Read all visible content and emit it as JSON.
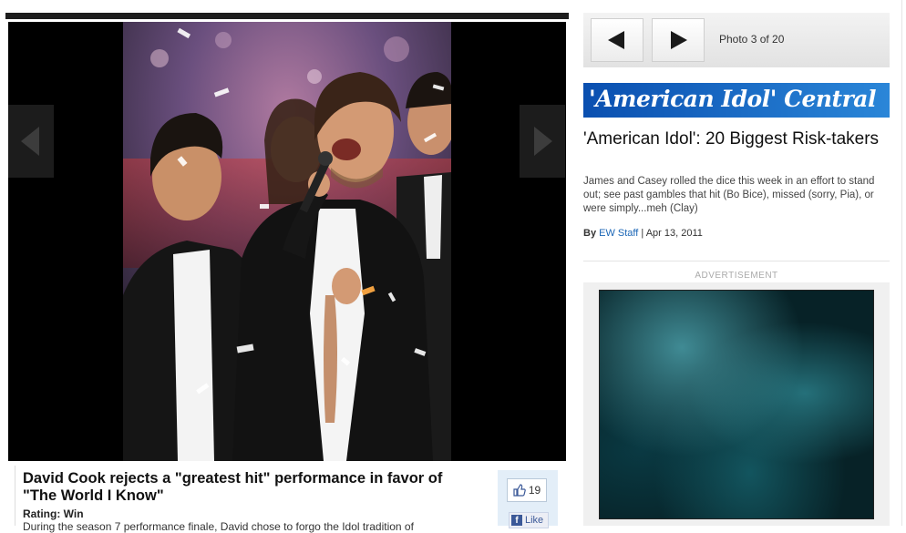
{
  "gallery": {
    "prev_label": "previous photo",
    "next_label": "next photo",
    "counter": "Photo 3 of 20"
  },
  "caption": {
    "title": "David Cook rejects a \"greatest hit\" performance in favor of \"The World I Know\"",
    "rating": "Rating: Win",
    "body": "During the season 7 performance finale, David chose to forgo the Idol tradition of"
  },
  "social": {
    "like_count": "19",
    "fb_like_label": "Like"
  },
  "banner": {
    "text": "'American Idol' Central"
  },
  "article": {
    "title": "'American Idol': 20 Biggest Risk-takers",
    "description": "James and Casey rolled the dice this week in an effort to stand out; see past gambles that hit (Bo Bice), missed (sorry, Pia), or were simply...meh (Clay)",
    "by_label": "By",
    "author": "EW Staff",
    "separator": "|",
    "date": "Apr 13, 2011"
  },
  "ad": {
    "label": "ADVERTISEMENT"
  },
  "colors": {
    "banner_blue": "#1a6bc8",
    "link_blue": "#1b66b6",
    "facebook_blue": "#3b5998"
  }
}
